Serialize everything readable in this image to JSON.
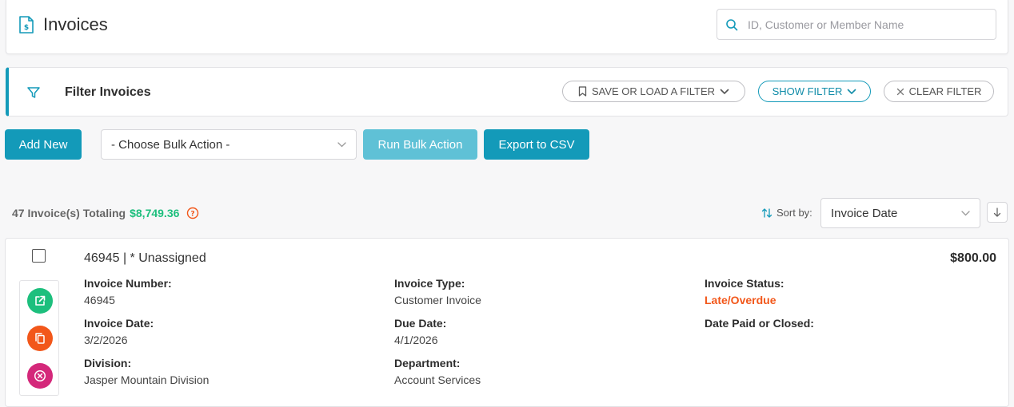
{
  "header": {
    "title": "Invoices",
    "search_placeholder": "ID, Customer or Member Name",
    "icon": "invoice-document-icon"
  },
  "filter": {
    "title": "Filter Invoices",
    "save_load_label": "SAVE OR LOAD A FILTER",
    "show_label": "SHOW FILTER",
    "clear_label": "CLEAR FILTER"
  },
  "actions": {
    "add_new_label": "Add New",
    "bulk_action_selected": "- Choose Bulk Action -",
    "run_bulk_label": "Run Bulk Action",
    "export_label": "Export to CSV"
  },
  "summary": {
    "count_text": "47 Invoice(s) Totaling",
    "total": "$8,749.36",
    "sort_label": "Sort by:",
    "sort_selected": "Invoice Date"
  },
  "invoices": [
    {
      "title": "46945 | * Unassigned",
      "amount": "$800.00",
      "invoice_number_label": "Invoice Number:",
      "invoice_number": "46945",
      "invoice_type_label": "Invoice Type:",
      "invoice_type": "Customer Invoice",
      "invoice_status_label": "Invoice Status:",
      "invoice_status": "Late/Overdue",
      "invoice_date_label": "Invoice Date:",
      "invoice_date": "3/2/2026",
      "due_date_label": "Due Date:",
      "due_date": "4/1/2026",
      "date_paid_label": "Date Paid or Closed:",
      "date_paid": "",
      "division_label": "Division:",
      "division": "Jasper Mountain Division",
      "department_label": "Department:",
      "department": "Account Services"
    }
  ],
  "colors": {
    "primary": "#139ab9",
    "primary_light": "#5fc1d6",
    "success": "#1dbf7d",
    "danger": "#f2571a",
    "pink": "#d4287a"
  }
}
